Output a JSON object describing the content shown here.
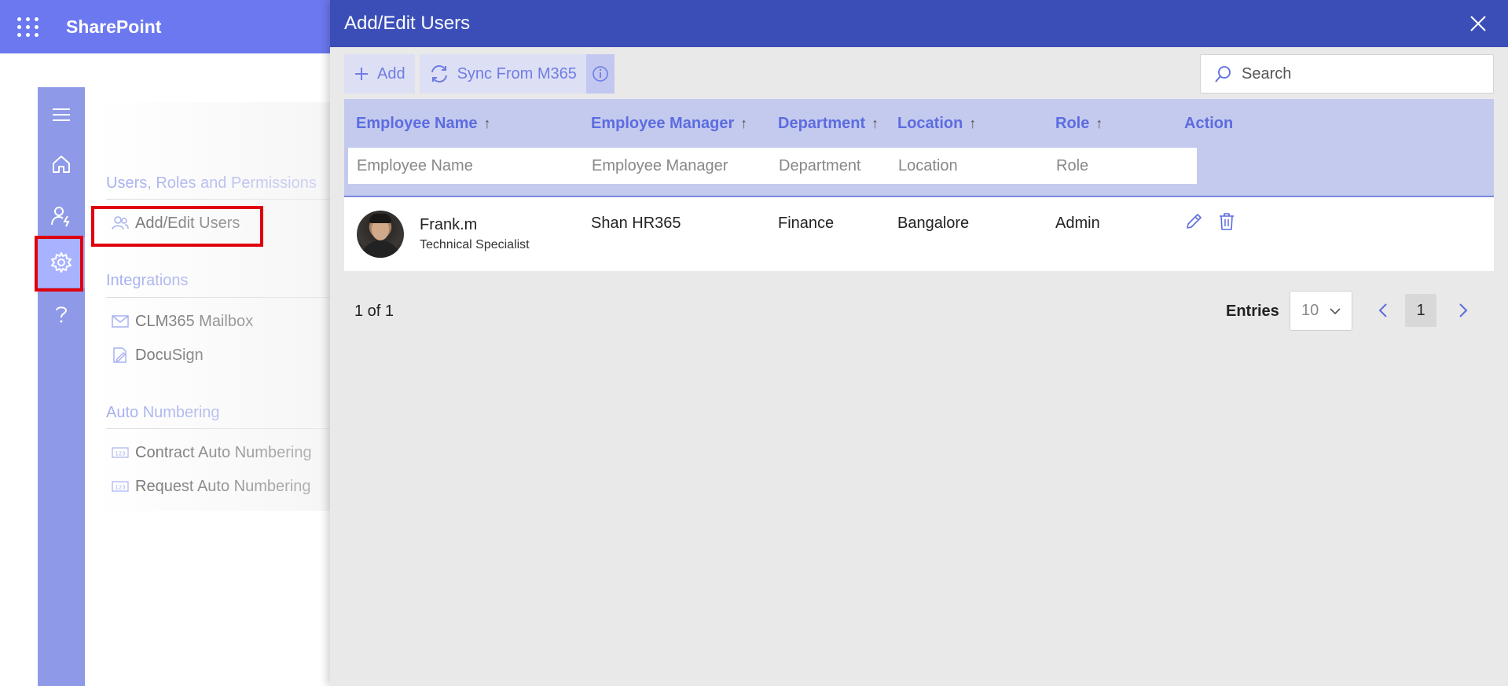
{
  "app": {
    "title": "SharePoint"
  },
  "rail": {
    "items": [
      {
        "icon": "menu-icon"
      },
      {
        "icon": "home-icon"
      },
      {
        "icon": "user-settings-icon"
      },
      {
        "icon": "gear-icon",
        "active": true
      },
      {
        "icon": "help-icon"
      }
    ]
  },
  "settings_nav": {
    "sections": [
      {
        "title": "Users, Roles and Permissions",
        "items": [
          {
            "label": "Add/Edit Users",
            "icon": "users-icon",
            "highlighted": true
          }
        ]
      },
      {
        "title": "Integrations",
        "items": [
          {
            "label": "CLM365 Mailbox",
            "icon": "mail-icon"
          },
          {
            "label": "DocuSign",
            "icon": "sign-icon"
          }
        ]
      },
      {
        "title": "Auto Numbering",
        "items": [
          {
            "label": "Contract Auto Numbering",
            "icon": "number-icon"
          },
          {
            "label": "Request Auto Numbering",
            "icon": "number-icon"
          }
        ]
      }
    ]
  },
  "panel": {
    "title": "Add/Edit Users",
    "toolbar": {
      "add_label": "Add",
      "sync_label": "Sync From M365"
    },
    "search": {
      "placeholder": "Search"
    },
    "table": {
      "columns": [
        {
          "label": "Employee Name",
          "sortable": true,
          "filter_placeholder": "Employee Name"
        },
        {
          "label": "Employee Manager",
          "sortable": true,
          "filter_placeholder": "Employee Manager"
        },
        {
          "label": "Department",
          "sortable": true,
          "filter_placeholder": "Department"
        },
        {
          "label": "Location",
          "sortable": true,
          "filter_placeholder": "Location"
        },
        {
          "label": "Role",
          "sortable": true,
          "filter_placeholder": "Role"
        },
        {
          "label": "Action",
          "sortable": false
        }
      ],
      "sort_arrow": "↑",
      "rows": [
        {
          "name": "Frank.m",
          "title": "Technical Specialist",
          "manager": "Shan HR365",
          "department": "Finance",
          "location": "Bangalore",
          "role": "Admin"
        }
      ]
    },
    "pagination": {
      "summary": "1 of 1",
      "entries_label": "Entries",
      "entries_value": "10",
      "current_page": "1"
    }
  },
  "colors": {
    "accent": "#3b4eb8",
    "link": "#5c6ce0",
    "highlight_border": "#e0000d"
  }
}
